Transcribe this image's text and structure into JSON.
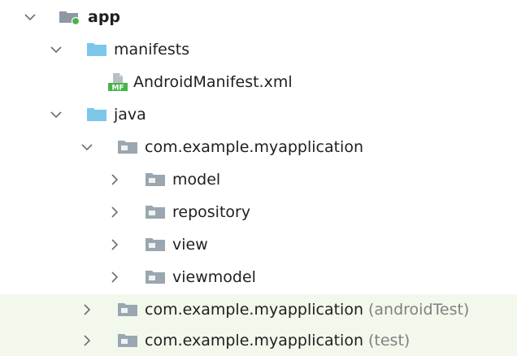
{
  "tree": {
    "app": {
      "label": "app"
    },
    "manifests": {
      "label": "manifests"
    },
    "android_manifest": {
      "label": "AndroidManifest.xml",
      "badge": "MF"
    },
    "java": {
      "label": "java"
    },
    "package_main": {
      "label": "com.example.myapplication"
    },
    "model": {
      "label": "model"
    },
    "repository": {
      "label": "repository"
    },
    "view": {
      "label": "view"
    },
    "viewmodel": {
      "label": "viewmodel"
    },
    "package_android_test": {
      "label": "com.example.myapplication",
      "suffix": "(androidTest)"
    },
    "package_test": {
      "label": "com.example.myapplication",
      "suffix": "(test)"
    }
  },
  "colors": {
    "folder_blue": "#7cc6ea",
    "package_gray": "#9aa7b0",
    "module_gray": "#8d98a2",
    "module_dot": "#45b549",
    "test_row_tint": "#f2f8ec",
    "suffix_gray": "#808080"
  },
  "icons": {
    "expanded": "chevron-down-icon",
    "collapsed": "chevron-right-icon",
    "module": "module-folder-icon",
    "folder": "folder-icon",
    "package": "package-folder-icon",
    "manifest": "manifest-file-icon"
  }
}
